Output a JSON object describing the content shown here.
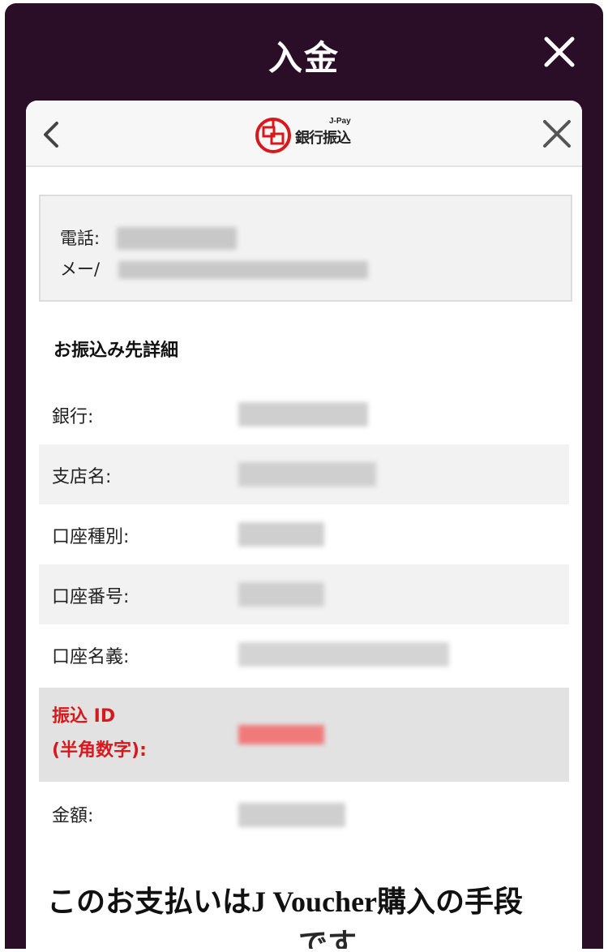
{
  "header": {
    "title": "入金"
  },
  "sheet": {
    "logo": {
      "brand_top": "J-Pay",
      "brand_main": "銀行振込"
    },
    "contact": {
      "phone_label": "電話:",
      "mail_label": "メー/"
    },
    "section_title": "お振込み先詳細",
    "rows": [
      {
        "label": "銀行:"
      },
      {
        "label": "支店名:"
      },
      {
        "label": "口座種別:"
      },
      {
        "label": "口座番号:"
      },
      {
        "label": "口座名義:"
      },
      {
        "label_line1": "振込 ID",
        "label_line2": "(半角数字):"
      },
      {
        "label": "金額:"
      }
    ],
    "promo": {
      "line1": "このお支払いはJ Voucher購入の手段",
      "line2": "です"
    }
  },
  "colors": {
    "outer_bg": "#2a0e28",
    "accent_red": "#d7191c",
    "row_shade": "#f2f2f2",
    "highlight_row": "#e2e2e2"
  }
}
